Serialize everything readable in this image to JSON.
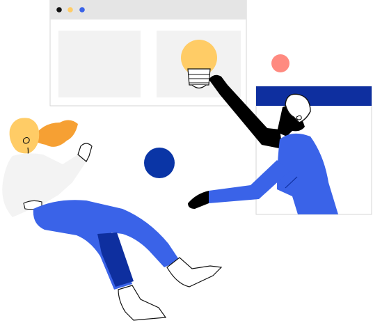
{
  "illustration": {
    "icons": {
      "browser_window": "browser-window-icon",
      "light_bulb": "light-bulb-icon",
      "woman": "woman-figure-icon",
      "man": "man-figure-icon",
      "blue_circle": "blue-circle-icon",
      "pink_circle": "pink-circle-icon",
      "side_window": "side-window-icon"
    },
    "colors": {
      "blue": "#3A63E8",
      "dark_blue": "#0E2F9F",
      "navy_circle": "#0A35A6",
      "yellow_bulb": "#FFCC66",
      "orange_hair": "#F6A033",
      "pink": "#FF8A80",
      "light_gray": "#F3F3F3",
      "header_gray": "#E5E5E5",
      "black": "#000000"
    }
  }
}
